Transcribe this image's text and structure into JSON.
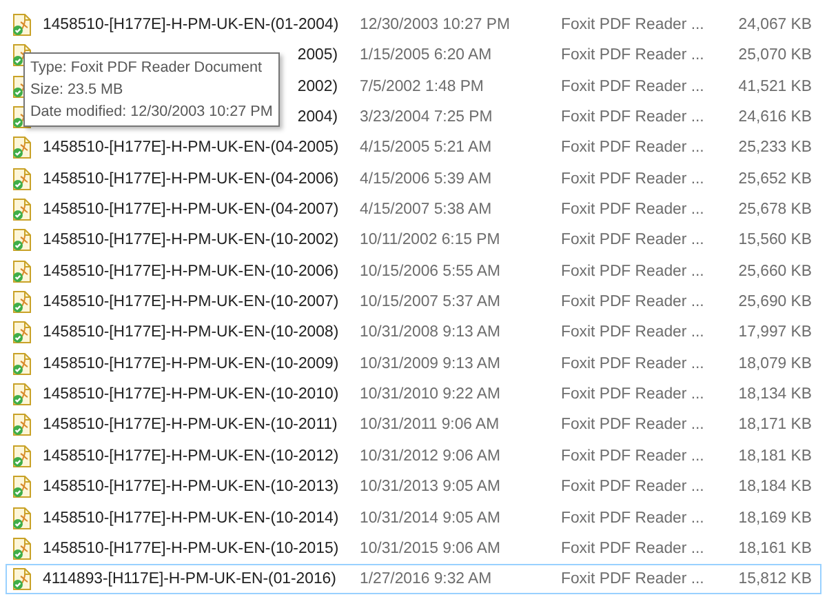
{
  "files": [
    {
      "name": "1458510-[H177E]-H-PM-UK-EN-(01-2004)",
      "date": "12/30/2003 10:27 PM",
      "type": "Foxit PDF Reader ...",
      "size": "24,067 KB",
      "selected": false
    },
    {
      "name": "2005)",
      "covered": true,
      "date": "1/15/2005 6:20 AM",
      "type": "Foxit PDF Reader ...",
      "size": "25,070 KB",
      "selected": false
    },
    {
      "name": "2002)",
      "covered": true,
      "date": "7/5/2002 1:48 PM",
      "type": "Foxit PDF Reader ...",
      "size": "41,521 KB",
      "selected": false
    },
    {
      "name": "2004)",
      "covered": true,
      "date": "3/23/2004 7:25 PM",
      "type": "Foxit PDF Reader ...",
      "size": "24,616 KB",
      "selected": false
    },
    {
      "name": "1458510-[H177E]-H-PM-UK-EN-(04-2005)",
      "date": "4/15/2005 5:21 AM",
      "type": "Foxit PDF Reader ...",
      "size": "25,233 KB",
      "selected": false
    },
    {
      "name": "1458510-[H177E]-H-PM-UK-EN-(04-2006)",
      "date": "4/15/2006 5:39 AM",
      "type": "Foxit PDF Reader ...",
      "size": "25,652 KB",
      "selected": false
    },
    {
      "name": "1458510-[H177E]-H-PM-UK-EN-(04-2007)",
      "date": "4/15/2007 5:38 AM",
      "type": "Foxit PDF Reader ...",
      "size": "25,678 KB",
      "selected": false
    },
    {
      "name": "1458510-[H177E]-H-PM-UK-EN-(10-2002)",
      "date": "10/11/2002 6:15 PM",
      "type": "Foxit PDF Reader ...",
      "size": "15,560 KB",
      "selected": false
    },
    {
      "name": "1458510-[H177E]-H-PM-UK-EN-(10-2006)",
      "date": "10/15/2006 5:55 AM",
      "type": "Foxit PDF Reader ...",
      "size": "25,660 KB",
      "selected": false
    },
    {
      "name": "1458510-[H177E]-H-PM-UK-EN-(10-2007)",
      "date": "10/15/2007 5:37 AM",
      "type": "Foxit PDF Reader ...",
      "size": "25,690 KB",
      "selected": false
    },
    {
      "name": "1458510-[H177E]-H-PM-UK-EN-(10-2008)",
      "date": "10/31/2008 9:13 AM",
      "type": "Foxit PDF Reader ...",
      "size": "17,997 KB",
      "selected": false
    },
    {
      "name": "1458510-[H177E]-H-PM-UK-EN-(10-2009)",
      "date": "10/31/2009 9:13 AM",
      "type": "Foxit PDF Reader ...",
      "size": "18,079 KB",
      "selected": false
    },
    {
      "name": "1458510-[H177E]-H-PM-UK-EN-(10-2010)",
      "date": "10/31/2010 9:22 AM",
      "type": "Foxit PDF Reader ...",
      "size": "18,134 KB",
      "selected": false
    },
    {
      "name": "1458510-[H177E]-H-PM-UK-EN-(10-2011)",
      "date": "10/31/2011 9:06 AM",
      "type": "Foxit PDF Reader ...",
      "size": "18,171 KB",
      "selected": false
    },
    {
      "name": "1458510-[H177E]-H-PM-UK-EN-(10-2012)",
      "date": "10/31/2012 9:06 AM",
      "type": "Foxit PDF Reader ...",
      "size": "18,181 KB",
      "selected": false
    },
    {
      "name": "1458510-[H177E]-H-PM-UK-EN-(10-2013)",
      "date": "10/31/2013 9:05 AM",
      "type": "Foxit PDF Reader ...",
      "size": "18,184 KB",
      "selected": false
    },
    {
      "name": "1458510-[H177E]-H-PM-UK-EN-(10-2014)",
      "date": "10/31/2014 9:05 AM",
      "type": "Foxit PDF Reader ...",
      "size": "18,169 KB",
      "selected": false
    },
    {
      "name": "1458510-[H177E]-H-PM-UK-EN-(10-2015)",
      "date": "10/31/2015 9:06 AM",
      "type": "Foxit PDF Reader ...",
      "size": "18,161 KB",
      "selected": false
    },
    {
      "name": "4114893-[H117E]-H-PM-UK-EN-(01-2016)",
      "date": "1/27/2016 9:32 AM",
      "type": "Foxit PDF Reader ...",
      "size": "15,812 KB",
      "selected": true
    }
  ],
  "tooltip": {
    "lines": [
      "Type: Foxit PDF Reader Document",
      "Size: 23.5 MB",
      "Date modified: 12/30/2003 10:27 PM"
    ]
  }
}
